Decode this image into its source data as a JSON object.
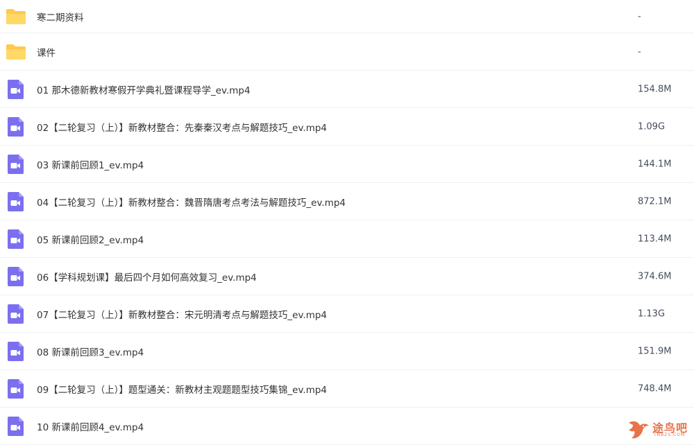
{
  "files": [
    {
      "type": "folder",
      "icon": "folder-icon",
      "name": "寒二期资料",
      "size": "-"
    },
    {
      "type": "folder",
      "icon": "folder-icon",
      "name": "课件",
      "size": "-"
    },
    {
      "type": "video",
      "icon": "video-file-icon",
      "name": "01 那木德新教材寒假开学典礼暨课程导学_ev.mp4",
      "size": "154.8M"
    },
    {
      "type": "video",
      "icon": "video-file-icon",
      "name": "02【二轮复习（上）】新教材整合：先秦秦汉考点与解题技巧_ev.mp4",
      "size": "1.09G"
    },
    {
      "type": "video",
      "icon": "video-file-icon",
      "name": "03 新课前回顾1_ev.mp4",
      "size": "144.1M"
    },
    {
      "type": "video",
      "icon": "video-file-icon",
      "name": "04【二轮复习（上）】新教材整合：魏晋隋唐考点考法与解题技巧_ev.mp4",
      "size": "872.1M"
    },
    {
      "type": "video",
      "icon": "video-file-icon",
      "name": "05 新课前回顾2_ev.mp4",
      "size": "113.4M"
    },
    {
      "type": "video",
      "icon": "video-file-icon",
      "name": "06【学科规划课】最后四个月如何高效复习_ev.mp4",
      "size": "374.6M"
    },
    {
      "type": "video",
      "icon": "video-file-icon",
      "name": "07【二轮复习（上）】新教材整合：宋元明清考点与解题技巧_ev.mp4",
      "size": "1.13G"
    },
    {
      "type": "video",
      "icon": "video-file-icon",
      "name": "08 新课前回顾3_ev.mp4",
      "size": "151.9M"
    },
    {
      "type": "video",
      "icon": "video-file-icon",
      "name": "09【二轮复习（上）】题型通关：新教材主观题题型技巧集锦_ev.mp4",
      "size": "748.4M"
    },
    {
      "type": "video",
      "icon": "video-file-icon",
      "name": "10 新课前回顾4_ev.mp4",
      "size": ""
    }
  ],
  "colors": {
    "folder": "#ffc94d",
    "video": "#7b6ff0"
  },
  "watermark": {
    "icon": "bird-logo-icon",
    "text": "途鸟吧",
    "sub": "TNBZS.COM"
  }
}
